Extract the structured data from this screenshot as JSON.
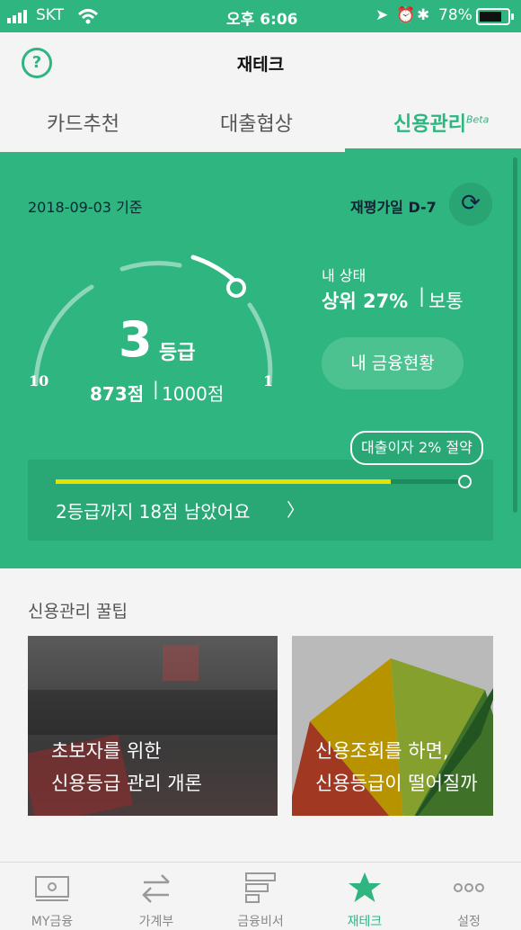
{
  "status_bar": {
    "carrier": "SKT",
    "time": "오후 6:06",
    "battery": "78%"
  },
  "header": {
    "title": "재테크",
    "help_icon": "question-icon"
  },
  "tabs": [
    {
      "label": "카드추천"
    },
    {
      "label": "대출협상"
    },
    {
      "label": "신용관리",
      "badge": "Beta"
    }
  ],
  "credit": {
    "date": "2018-09-03 기준",
    "reevaluation": "재평가일 D-7",
    "grade_number": "3",
    "grade_unit": "등급",
    "score": "873점",
    "max_score": "1000점",
    "scale_min": "10",
    "scale_max": "1",
    "my_status_label": "내 상태",
    "rank": "상위 27%",
    "rank_status": "보통",
    "finance_button": "내 금융현황",
    "loan_badge": "대출이자 2% 절약",
    "next_grade_text": "2등급까지 18점 남았어요",
    "progress_fraction": 0.82
  },
  "tips": {
    "title": "신용관리 꿀팁",
    "cards": [
      {
        "line1": "초보자를 위한",
        "line2": "신용등급 관리 개론"
      },
      {
        "line1": "신용조회를 하면,",
        "line2": "신용등급이 떨어질까"
      }
    ]
  },
  "tab_bar": [
    {
      "label": "MY금융",
      "icon": "wallet-icon"
    },
    {
      "label": "가계부",
      "icon": "transfer-icon"
    },
    {
      "label": "금융비서",
      "icon": "list-icon"
    },
    {
      "label": "재테크",
      "icon": "star-icon",
      "active": true
    },
    {
      "label": "설정",
      "icon": "more-icon"
    }
  ],
  "colors": {
    "brand_green": "#2fb580",
    "progress_yellow": "#e8e000"
  }
}
